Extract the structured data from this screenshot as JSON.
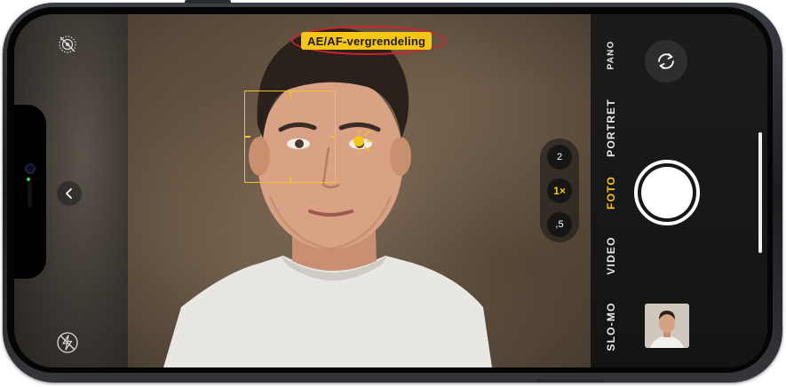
{
  "viewfinder": {
    "ae_af_lock_label": "AE/AF-vergrendeling"
  },
  "zoom": {
    "options": [
      "2",
      "1×",
      ",5"
    ],
    "selected": "1×"
  },
  "modes": {
    "items": [
      "PANO",
      "PORTRET",
      "FOTO",
      "VIDEO",
      "SLO-MO"
    ],
    "active": "FOTO"
  },
  "icons": {
    "live_photo": "live-photo-off-icon",
    "flash": "flash-off-icon",
    "controls": "chevron-left-icon",
    "switch_camera": "camera-rotate-icon"
  },
  "colors": {
    "accent": "#f5c518",
    "highlight_ring": "#d2232a"
  }
}
